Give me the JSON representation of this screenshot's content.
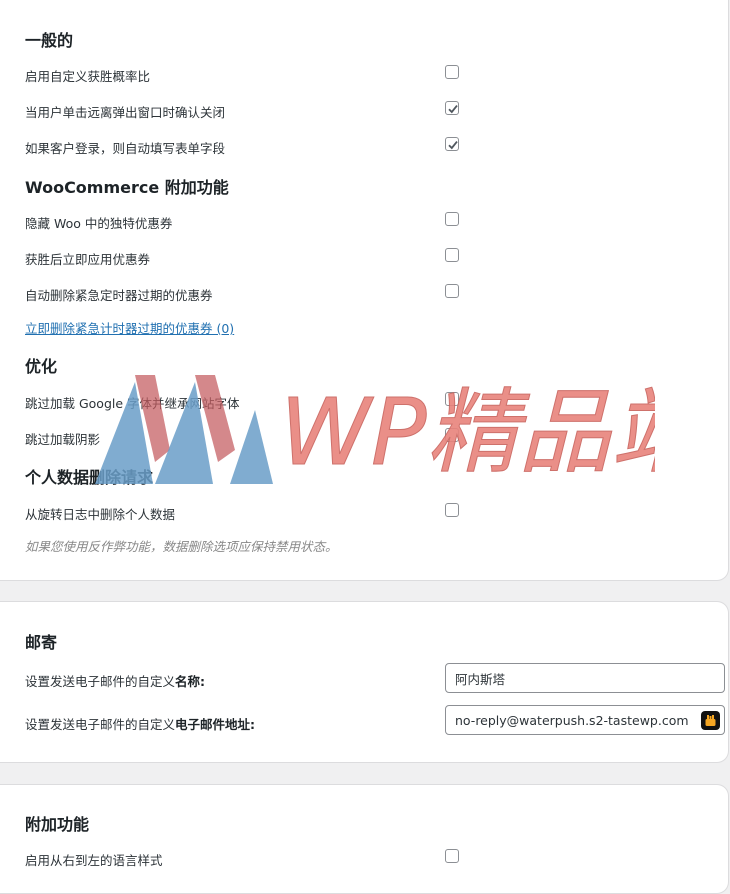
{
  "general": {
    "heading": "一般的",
    "rows": [
      {
        "label": "启用自定义获胜概率比",
        "checked": false
      },
      {
        "label": "当用户单击远离弹出窗口时确认关闭",
        "checked": true
      },
      {
        "label": "如果客户登录，则自动填写表单字段",
        "checked": true
      }
    ]
  },
  "woocommerce": {
    "heading": "WooCommerce 附加功能",
    "rows": [
      {
        "label": "隐藏 Woo 中的独特优惠券",
        "checked": false
      },
      {
        "label": "获胜后立即应用优惠券",
        "checked": false
      },
      {
        "label": "自动删除紧急定时器过期的优惠券",
        "checked": false
      }
    ],
    "delete_link": "立即删除紧急计时器过期的优惠券 (0)"
  },
  "optimization": {
    "heading": "优化",
    "rows": [
      {
        "label": "跳过加载 Google 字体并继承网站字体",
        "checked": false
      },
      {
        "label": "跳过加载阴影",
        "checked": false
      }
    ]
  },
  "privacy": {
    "heading": "个人数据删除请求",
    "rows": [
      {
        "label": "从旋转日志中删除个人数据",
        "checked": false
      }
    ],
    "note": "如果您使用反作弊功能，数据删除选项应保持禁用状态。"
  },
  "mail": {
    "heading": "邮寄",
    "sender_name": {
      "label_prefix": "设置发送电子邮件的自定义",
      "label_bold": "名称:",
      "value": "阿内斯塔"
    },
    "sender_email": {
      "label_prefix": "设置发送电子邮件的自定义",
      "label_bold": "电子邮件地址:",
      "value": "no-reply@waterpush.s2-tastewp.com"
    }
  },
  "extras": {
    "heading": "附加功能",
    "rows": [
      {
        "label": "启用从右到左的语言样式",
        "checked": false
      }
    ]
  },
  "watermark": {
    "text": "WP精品站"
  },
  "colors": {
    "link": "#2271b1",
    "watermark_red": "#e8837c",
    "watermark_blue": "#7aa9cc"
  }
}
